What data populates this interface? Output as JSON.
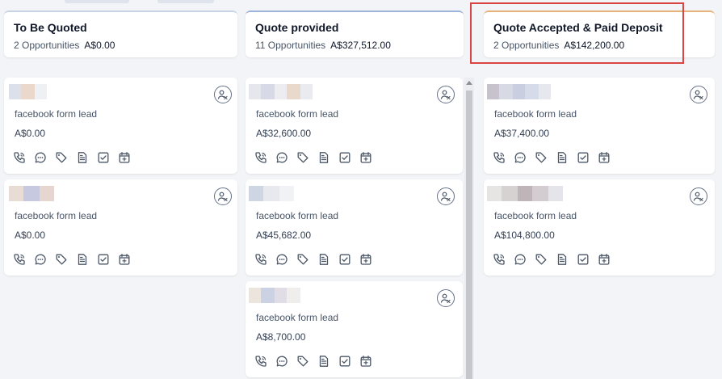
{
  "columns": [
    {
      "title": "To Be Quoted",
      "count": "2 Opportunities",
      "amount": "A$0.00",
      "accent": "#c9d3e6",
      "cards": [
        {
          "source": "facebook form lead",
          "value": "A$0.00",
          "name_blur": [
            "#dce0ea",
            "#e9d8cb",
            "#eef0f4"
          ]
        },
        {
          "source": "facebook form lead",
          "value": "A$0.00",
          "name_blur": [
            "#e8dcd5",
            "#c7c9e1",
            "#e5d6cf"
          ]
        }
      ]
    },
    {
      "title": "Quote provided",
      "count": "11 Opportunities",
      "amount": "A$327,512.00",
      "accent": "#9db3d9",
      "cards": [
        {
          "source": "facebook form lead",
          "value": "A$32,600.00",
          "name_blur": [
            "#e6e7ec",
            "#d8d9e6",
            "#ececf1",
            "#e8d9cc",
            "#e9ebf0"
          ]
        },
        {
          "source": "facebook form lead",
          "value": "A$45,682.00",
          "name_blur": [
            "#ced5e3",
            "#e7e9ee",
            "#f1f2f5"
          ]
        },
        {
          "source": "facebook form lead",
          "value": "A$8,700.00",
          "name_blur": [
            "#ebe5dd",
            "#cbd2e3",
            "#e0dde6",
            "#f0eeec"
          ]
        }
      ]
    },
    {
      "title": "Quote Accepted & Paid Deposit",
      "count": "2 Opportunities",
      "amount": "A$142,200.00",
      "accent": "#e7b277",
      "cards": [
        {
          "source": "facebook form lead",
          "value": "A$37,400.00",
          "name_blur": [
            "#c8c2cc",
            "#d7d9e4",
            "#c9cfe0",
            "#d5dbe8",
            "#e6e8ee"
          ]
        },
        {
          "source": "facebook form lead",
          "value": "A$104,800.00",
          "name_blur": [
            "#e7e5e3",
            "#d6d2d2",
            "#bfb4b8",
            "#d3ccd0",
            "#e5e4ea"
          ]
        }
      ]
    }
  ],
  "colors": {
    "highlight": "#d94444",
    "icon": "#4a5565",
    "card_bg": "#ffffff",
    "board_bg": "#f2f4f7"
  },
  "card_actions": [
    "phone-icon",
    "message-icon",
    "tag-icon",
    "document-icon",
    "task-icon",
    "calendar-add-icon"
  ]
}
